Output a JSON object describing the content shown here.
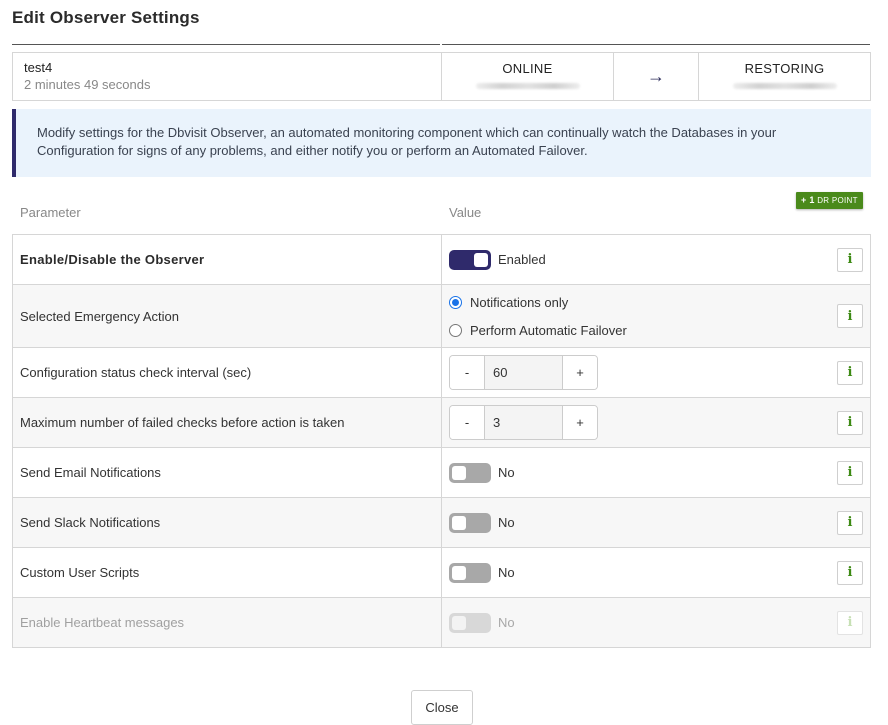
{
  "dialog": {
    "title": "Edit Observer Settings"
  },
  "status": {
    "name": "test4",
    "elapsed": "2 minutes 49 seconds",
    "from_state": "ONLINE",
    "to_state": "RESTORING",
    "arrow": "→"
  },
  "info_text": "Modify settings for the Dbvisit Observer, an automated monitoring component which can continually watch the Databases in your Configuration for signs of any problems, and either notify you or perform an Automated Failover.",
  "badge": {
    "plus": "+ 1",
    "text": "DR POINT"
  },
  "columns": {
    "parameter": "Parameter",
    "value": "Value"
  },
  "rows": {
    "enable_observer": {
      "label": "Enable/Disable the Observer",
      "state": "Enabled"
    },
    "emergency_action": {
      "label": "Selected Emergency Action",
      "options": [
        "Notifications only",
        "Perform Automatic Failover"
      ],
      "selected": "Notifications only"
    },
    "check_interval": {
      "label": "Configuration status check interval (sec)",
      "value": "60",
      "minus": "-",
      "plus": "+"
    },
    "max_failed": {
      "label": "Maximum number of failed checks before action is taken",
      "value": "3",
      "minus": "-",
      "plus": "+"
    },
    "email": {
      "label": "Send Email Notifications",
      "state": "No"
    },
    "slack": {
      "label": "Send Slack Notifications",
      "state": "No"
    },
    "scripts": {
      "label": "Custom User Scripts",
      "state": "No"
    },
    "heartbeat": {
      "label": "Enable Heartbeat messages",
      "state": "No"
    }
  },
  "info_icon": "i",
  "footer": {
    "close_label": "Close"
  },
  "colors": {
    "accent": "#2f2a6b",
    "info_green": "#3d8a14",
    "badge_green": "#4a8a1b",
    "banner_bg": "#eaf3fc"
  }
}
